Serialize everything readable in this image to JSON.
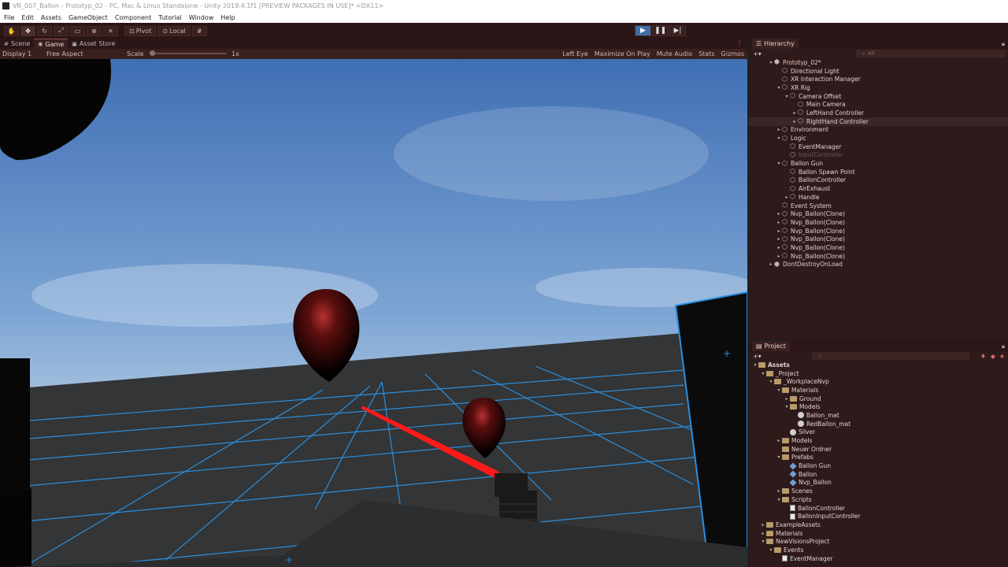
{
  "window": {
    "title": "VR_007_Ballon - Prototyp_02 - PC, Mac & Linux Standalone - Unity 2019.4.1f1 [PREVIEW PACKAGES IN USE]* <DX11>"
  },
  "menu": [
    "File",
    "Edit",
    "Assets",
    "GameObject",
    "Component",
    "Tutorial",
    "Window",
    "Help"
  ],
  "toolbar": {
    "tools": [
      "hand",
      "move",
      "rotate",
      "scale",
      "rect",
      "transform",
      "custom"
    ],
    "pivot_label": "Pivot",
    "local_label": "Local"
  },
  "game_view": {
    "tabs": [
      {
        "label": "Scene"
      },
      {
        "label": "Game"
      },
      {
        "label": "Asset Store"
      }
    ],
    "display": "Display 1",
    "aspect": "Free Aspect",
    "scale_label": "Scale",
    "scale_value": "1x",
    "scale_level": 0.0,
    "eye": "Left Eye",
    "maximize": "Maximize On Play",
    "mute": "Mute Audio",
    "stats": "Stats",
    "gizmos": "Gizmos"
  },
  "hierarchy": {
    "title": "Hierarchy",
    "search_placeholder": "All",
    "items": [
      {
        "label": "Prototyp_02*",
        "indent": 0,
        "arrow": "▾",
        "kind": "scene"
      },
      {
        "label": "Directional Light",
        "indent": 1,
        "arrow": "",
        "kind": "obj"
      },
      {
        "label": "XR Interaction Manager",
        "indent": 1,
        "arrow": "",
        "kind": "obj"
      },
      {
        "label": "XR Rig",
        "indent": 1,
        "arrow": "▾",
        "kind": "obj"
      },
      {
        "label": "Camera Offset",
        "indent": 2,
        "arrow": "▾",
        "kind": "obj"
      },
      {
        "label": "Main Camera",
        "indent": 3,
        "arrow": "",
        "kind": "obj"
      },
      {
        "label": "LeftHand Controller",
        "indent": 3,
        "arrow": "▸",
        "kind": "obj"
      },
      {
        "label": "RightHand Controller",
        "indent": 3,
        "arrow": "▸",
        "kind": "obj",
        "selected": true
      },
      {
        "label": "Environment",
        "indent": 1,
        "arrow": "▸",
        "kind": "obj"
      },
      {
        "label": "Logic",
        "indent": 1,
        "arrow": "▾",
        "kind": "obj"
      },
      {
        "label": "EventManager",
        "indent": 2,
        "arrow": "",
        "kind": "obj"
      },
      {
        "label": "InputController",
        "indent": 2,
        "arrow": "",
        "kind": "obj",
        "dim": true
      },
      {
        "label": "Ballon Gun",
        "indent": 1,
        "arrow": "▾",
        "kind": "obj"
      },
      {
        "label": "Ballon Spawn Point",
        "indent": 2,
        "arrow": "",
        "kind": "obj"
      },
      {
        "label": "BallonController",
        "indent": 2,
        "arrow": "",
        "kind": "obj"
      },
      {
        "label": "AirExhaust",
        "indent": 2,
        "arrow": "",
        "kind": "obj"
      },
      {
        "label": "Handle",
        "indent": 2,
        "arrow": "▸",
        "kind": "obj"
      },
      {
        "label": "Event System",
        "indent": 1,
        "arrow": "",
        "kind": "obj"
      },
      {
        "label": "Nvp_Ballon(Clone)",
        "indent": 1,
        "arrow": "▸",
        "kind": "obj"
      },
      {
        "label": "Nvp_Ballon(Clone)",
        "indent": 1,
        "arrow": "▸",
        "kind": "obj"
      },
      {
        "label": "Nvp_Ballon(Clone)",
        "indent": 1,
        "arrow": "▸",
        "kind": "obj"
      },
      {
        "label": "Nvp_Ballon(Clone)",
        "indent": 1,
        "arrow": "▸",
        "kind": "obj"
      },
      {
        "label": "Nvp_Ballon(Clone)",
        "indent": 1,
        "arrow": "▸",
        "kind": "obj"
      },
      {
        "label": "Nvp_Ballon(Clone)",
        "indent": 1,
        "arrow": "▸",
        "kind": "obj"
      },
      {
        "label": "DontDestroyOnLoad",
        "indent": 0,
        "arrow": "▸",
        "kind": "scene"
      }
    ]
  },
  "project": {
    "title": "Project",
    "items": [
      {
        "label": "Assets",
        "indent": 0,
        "arrow": "▾",
        "kind": "folder",
        "bold": true
      },
      {
        "label": "_Project",
        "indent": 1,
        "arrow": "▾",
        "kind": "folder"
      },
      {
        "label": "_WorkplaceNvp",
        "indent": 2,
        "arrow": "▾",
        "kind": "folder"
      },
      {
        "label": "Materials",
        "indent": 3,
        "arrow": "▾",
        "kind": "folder"
      },
      {
        "label": "Ground",
        "indent": 4,
        "arrow": "▸",
        "kind": "folder"
      },
      {
        "label": "Models",
        "indent": 4,
        "arrow": "▾",
        "kind": "folder"
      },
      {
        "label": "Ballon_mat",
        "indent": 5,
        "arrow": "",
        "kind": "sphere"
      },
      {
        "label": "RedBallon_mat",
        "indent": 5,
        "arrow": "",
        "kind": "sphere"
      },
      {
        "label": "Silver",
        "indent": 4,
        "arrow": "",
        "kind": "sphere"
      },
      {
        "label": "Models",
        "indent": 3,
        "arrow": "▸",
        "kind": "folder"
      },
      {
        "label": "Neuer Ordner",
        "indent": 3,
        "arrow": "",
        "kind": "folder"
      },
      {
        "label": "Prefabs",
        "indent": 3,
        "arrow": "▾",
        "kind": "folder"
      },
      {
        "label": "Ballon Gun",
        "indent": 4,
        "arrow": "",
        "kind": "prefab"
      },
      {
        "label": "Ballon",
        "indent": 4,
        "arrow": "",
        "kind": "prefab"
      },
      {
        "label": "Nvp_Ballon",
        "indent": 4,
        "arrow": "",
        "kind": "prefab"
      },
      {
        "label": "Scenes",
        "indent": 3,
        "arrow": "▸",
        "kind": "folder"
      },
      {
        "label": "Scripts",
        "indent": 3,
        "arrow": "▾",
        "kind": "folder"
      },
      {
        "label": "BallonController",
        "indent": 4,
        "arrow": "",
        "kind": "script"
      },
      {
        "label": "BallonInputController",
        "indent": 4,
        "arrow": "",
        "kind": "script"
      },
      {
        "label": "ExampleAssets",
        "indent": 1,
        "arrow": "▸",
        "kind": "folder"
      },
      {
        "label": "Materials",
        "indent": 1,
        "arrow": "▸",
        "kind": "folder"
      },
      {
        "label": "NewVisionsProject",
        "indent": 1,
        "arrow": "▾",
        "kind": "folder"
      },
      {
        "label": "Events",
        "indent": 2,
        "arrow": "▾",
        "kind": "folder"
      },
      {
        "label": "EventManager",
        "indent": 3,
        "arrow": "",
        "kind": "script"
      }
    ]
  },
  "colors": {
    "editor_tint": "#2e1a1a",
    "play_active": "#3e6ea8",
    "grid_line": "#2a8fe0",
    "laser": "#ff1a1a",
    "balloon": "#8a1c1c"
  }
}
